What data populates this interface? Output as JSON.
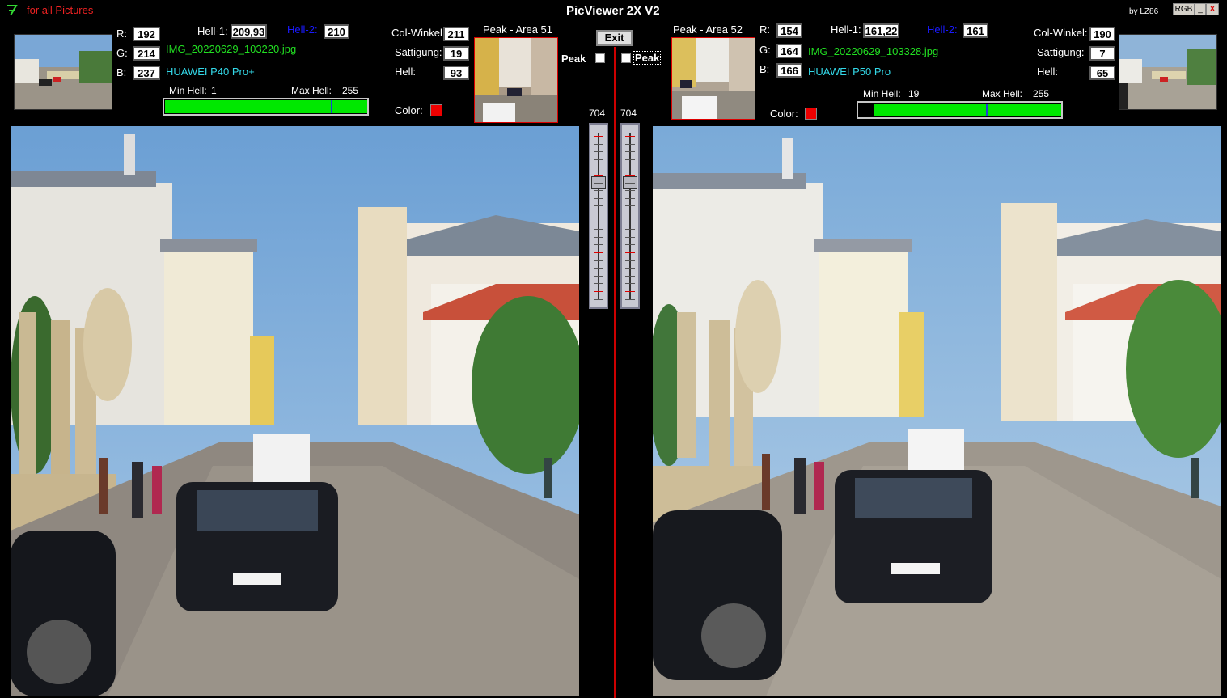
{
  "app": {
    "logo_text": "for all Pictures",
    "title": "PicViewer 2X V2",
    "by": "by LZ86",
    "window_buttons": [
      "RGB",
      "_",
      "X"
    ],
    "exit_label": "Exit"
  },
  "left": {
    "r_label": "R:",
    "r": "192",
    "g_label": "G:",
    "g": "214",
    "b_label": "B:",
    "b": "237",
    "hell1_label": "Hell-1:",
    "hell1": "209,93",
    "hell2_label": "Hell-2:",
    "hell2": "210",
    "filename": "IMG_20220629_103220.jpg",
    "camera": "HUAWEI P40 Pro+",
    "min_hell_label": "Min Hell:",
    "min_hell": "1",
    "max_hell_label": "Max Hell:",
    "max_hell": "255",
    "colwinkel_label": "Col-Winkel:",
    "colwinkel": "211",
    "saettigung_label": "Sättigung:",
    "saettigung": "19",
    "hell_label": "Hell:",
    "hell": "93",
    "color_label": "Color:",
    "peak_area_label": "Peak - Area 51",
    "peak_label": "Peak",
    "slider_value": "704",
    "histogram": {
      "fill_start": 0.004,
      "fill_end": 1.0,
      "marker": 0.82
    }
  },
  "right": {
    "r_label": "R:",
    "r": "154",
    "g_label": "G:",
    "g": "164",
    "b_label": "B:",
    "b": "166",
    "hell1_label": "Hell-1:",
    "hell1": "161,22",
    "hell2_label": "Hell-2:",
    "hell2": "161",
    "filename": "IMG_20220629_103328.jpg",
    "camera": "HUAWEI P50 Pro",
    "min_hell_label": "Min Hell:",
    "min_hell": "19",
    "max_hell_label": "Max Hell:",
    "max_hell": "255",
    "colwinkel_label": "Col-Winkel:",
    "colwinkel": "190",
    "saettigung_label": "Sättigung:",
    "saettigung": "7",
    "hell_label": "Hell:",
    "hell": "65",
    "color_label": "Color:",
    "peak_area_label": "Peak - Area 52",
    "peak_label": "Peak",
    "slider_value": "704",
    "histogram": {
      "fill_start": 0.075,
      "fill_end": 1.0,
      "marker": 0.63
    }
  },
  "colors": {
    "filename": "#22e022",
    "camera": "#33d8e8",
    "hell2": "#1a1aff",
    "logo": "#ee2222",
    "histogram_fill": "#00e800",
    "peak_box": "#ee0000"
  }
}
